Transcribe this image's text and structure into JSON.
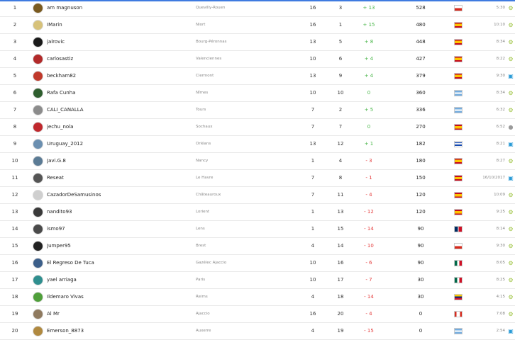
{
  "colors": {
    "positive": "#49b649",
    "negative": "#e43d3d",
    "android": "#9bc23c",
    "desktop": "#2a9bd6",
    "apple": "#9a9a9a"
  },
  "rows": [
    {
      "rank": "1",
      "name": "am magnuson",
      "team": "Quevilly-Rouen",
      "played": "16",
      "pos": "3",
      "diff": "+ 13",
      "diff_sign": "pos",
      "points": "528",
      "flag": "chile",
      "time": "5:30",
      "os": "android-icon",
      "avatar": "#7a5a1f"
    },
    {
      "rank": "2",
      "name": "IMarin",
      "team": "Niort",
      "played": "16",
      "pos": "1",
      "diff": "+ 15",
      "diff_sign": "pos",
      "points": "480",
      "flag": "spain",
      "time": "10:10",
      "os": "android-icon",
      "avatar": "#d7c27a"
    },
    {
      "rank": "3",
      "name": "jalrovic",
      "team": "Bourg-Péronnas",
      "played": "13",
      "pos": "5",
      "diff": "+ 8",
      "diff_sign": "pos",
      "points": "448",
      "flag": "spain",
      "time": "8:34",
      "os": "android-icon",
      "avatar": "#1a1a1a"
    },
    {
      "rank": "4",
      "name": "carlosastiz",
      "team": "Valenciennes",
      "played": "10",
      "pos": "6",
      "diff": "+ 4",
      "diff_sign": "pos",
      "points": "427",
      "flag": "spain",
      "time": "8:22",
      "os": "android-icon",
      "avatar": "#b22a2a"
    },
    {
      "rank": "5",
      "name": "beckham82",
      "team": "Clermont",
      "played": "13",
      "pos": "9",
      "diff": "+ 4",
      "diff_sign": "pos",
      "points": "379",
      "flag": "spain",
      "time": "9:30",
      "os": "desktop-icon",
      "avatar": "#c0392b"
    },
    {
      "rank": "6",
      "name": "Rafa Cunha",
      "team": "Nîmes",
      "played": "10",
      "pos": "10",
      "diff": "0",
      "diff_sign": "zero",
      "points": "360",
      "flag": "argentina",
      "time": "8:34",
      "os": "android-icon",
      "avatar": "#2e5e2e"
    },
    {
      "rank": "7",
      "name": "CALI_CANALLA",
      "team": "Tours",
      "played": "7",
      "pos": "2",
      "diff": "+ 5",
      "diff_sign": "pos",
      "points": "336",
      "flag": "argentina",
      "time": "6:32",
      "os": "android-icon",
      "avatar": "#8c8c8c"
    },
    {
      "rank": "8",
      "name": "jechu_nola",
      "team": "Sochaux",
      "played": "7",
      "pos": "7",
      "diff": "0",
      "diff_sign": "zero",
      "points": "270",
      "flag": "spain",
      "time": "6:52",
      "os": "apple-icon",
      "avatar": "#c0282d"
    },
    {
      "rank": "9",
      "name": "Uruguay_2012",
      "team": "Orléans",
      "played": "13",
      "pos": "12",
      "diff": "+ 1",
      "diff_sign": "pos",
      "points": "182",
      "flag": "uruguay",
      "time": "8:21",
      "os": "desktop-icon",
      "avatar": "#6b8fb0"
    },
    {
      "rank": "10",
      "name": "Javi.G.8",
      "team": "Nancy",
      "played": "1",
      "pos": "4",
      "diff": "- 3",
      "diff_sign": "neg",
      "points": "180",
      "flag": "spain",
      "time": "8:27",
      "os": "android-icon",
      "avatar": "#5b7b95"
    },
    {
      "rank": "11",
      "name": "Reseat",
      "team": "Le Havre",
      "played": "7",
      "pos": "8",
      "diff": "- 1",
      "diff_sign": "neg",
      "points": "150",
      "flag": "spain",
      "time": "16/10/2017",
      "os": "desktop-icon",
      "avatar": "#555555"
    },
    {
      "rank": "12",
      "name": "CazadorDeSamusinos",
      "team": "Châteauroux",
      "played": "7",
      "pos": "11",
      "diff": "- 4",
      "diff_sign": "neg",
      "points": "120",
      "flag": "spain",
      "time": "10:09",
      "os": "android-icon",
      "avatar": "#cfcfcf"
    },
    {
      "rank": "13",
      "name": "nandito93",
      "team": "Lorient",
      "played": "1",
      "pos": "13",
      "diff": "- 12",
      "diff_sign": "neg",
      "points": "120",
      "flag": "spain",
      "time": "9:25",
      "os": "android-icon",
      "avatar": "#3a3a3a"
    },
    {
      "rank": "14",
      "name": "ismo97",
      "team": "Lens",
      "played": "1",
      "pos": "15",
      "diff": "- 14",
      "diff_sign": "neg",
      "points": "90",
      "flag": "dominican",
      "time": "8:14",
      "os": "android-icon",
      "avatar": "#4a4a4a"
    },
    {
      "rank": "15",
      "name": "Jumper95",
      "team": "Brest",
      "played": "4",
      "pos": "14",
      "diff": "- 10",
      "diff_sign": "neg",
      "points": "90",
      "flag": "chile",
      "time": "9:30",
      "os": "android-icon",
      "avatar": "#222222"
    },
    {
      "rank": "16",
      "name": "El Regreso De Tuca",
      "team": "Gazélec Ajaccio",
      "played": "10",
      "pos": "16",
      "diff": "- 6",
      "diff_sign": "neg",
      "points": "90",
      "flag": "mexico",
      "time": "8:05",
      "os": "android-icon",
      "avatar": "#3c5f8a"
    },
    {
      "rank": "17",
      "name": "yael arriaga",
      "team": "Paris",
      "played": "10",
      "pos": "17",
      "diff": "- 7",
      "diff_sign": "neg",
      "points": "30",
      "flag": "mexico",
      "time": "8:25",
      "os": "android-icon",
      "avatar": "#2f8f8f"
    },
    {
      "rank": "18",
      "name": "Ildemaro Vivas",
      "team": "Reims",
      "played": "4",
      "pos": "18",
      "diff": "- 14",
      "diff_sign": "neg",
      "points": "30",
      "flag": "venezuela",
      "time": "4:15",
      "os": "android-icon",
      "avatar": "#4f9f3a"
    },
    {
      "rank": "19",
      "name": "Al Mr",
      "team": "Ajaccio",
      "played": "16",
      "pos": "20",
      "diff": "- 4",
      "diff_sign": "neg",
      "points": "0",
      "flag": "canada",
      "time": "7:08",
      "os": "android-icon",
      "avatar": "#8f7a5f"
    },
    {
      "rank": "20",
      "name": "Emerson_8873",
      "team": "Auxerre",
      "played": "4",
      "pos": "19",
      "diff": "- 15",
      "diff_sign": "neg",
      "points": "0",
      "flag": "argentina",
      "time": "2:54",
      "os": "desktop-icon",
      "avatar": "#b0893f"
    }
  ]
}
